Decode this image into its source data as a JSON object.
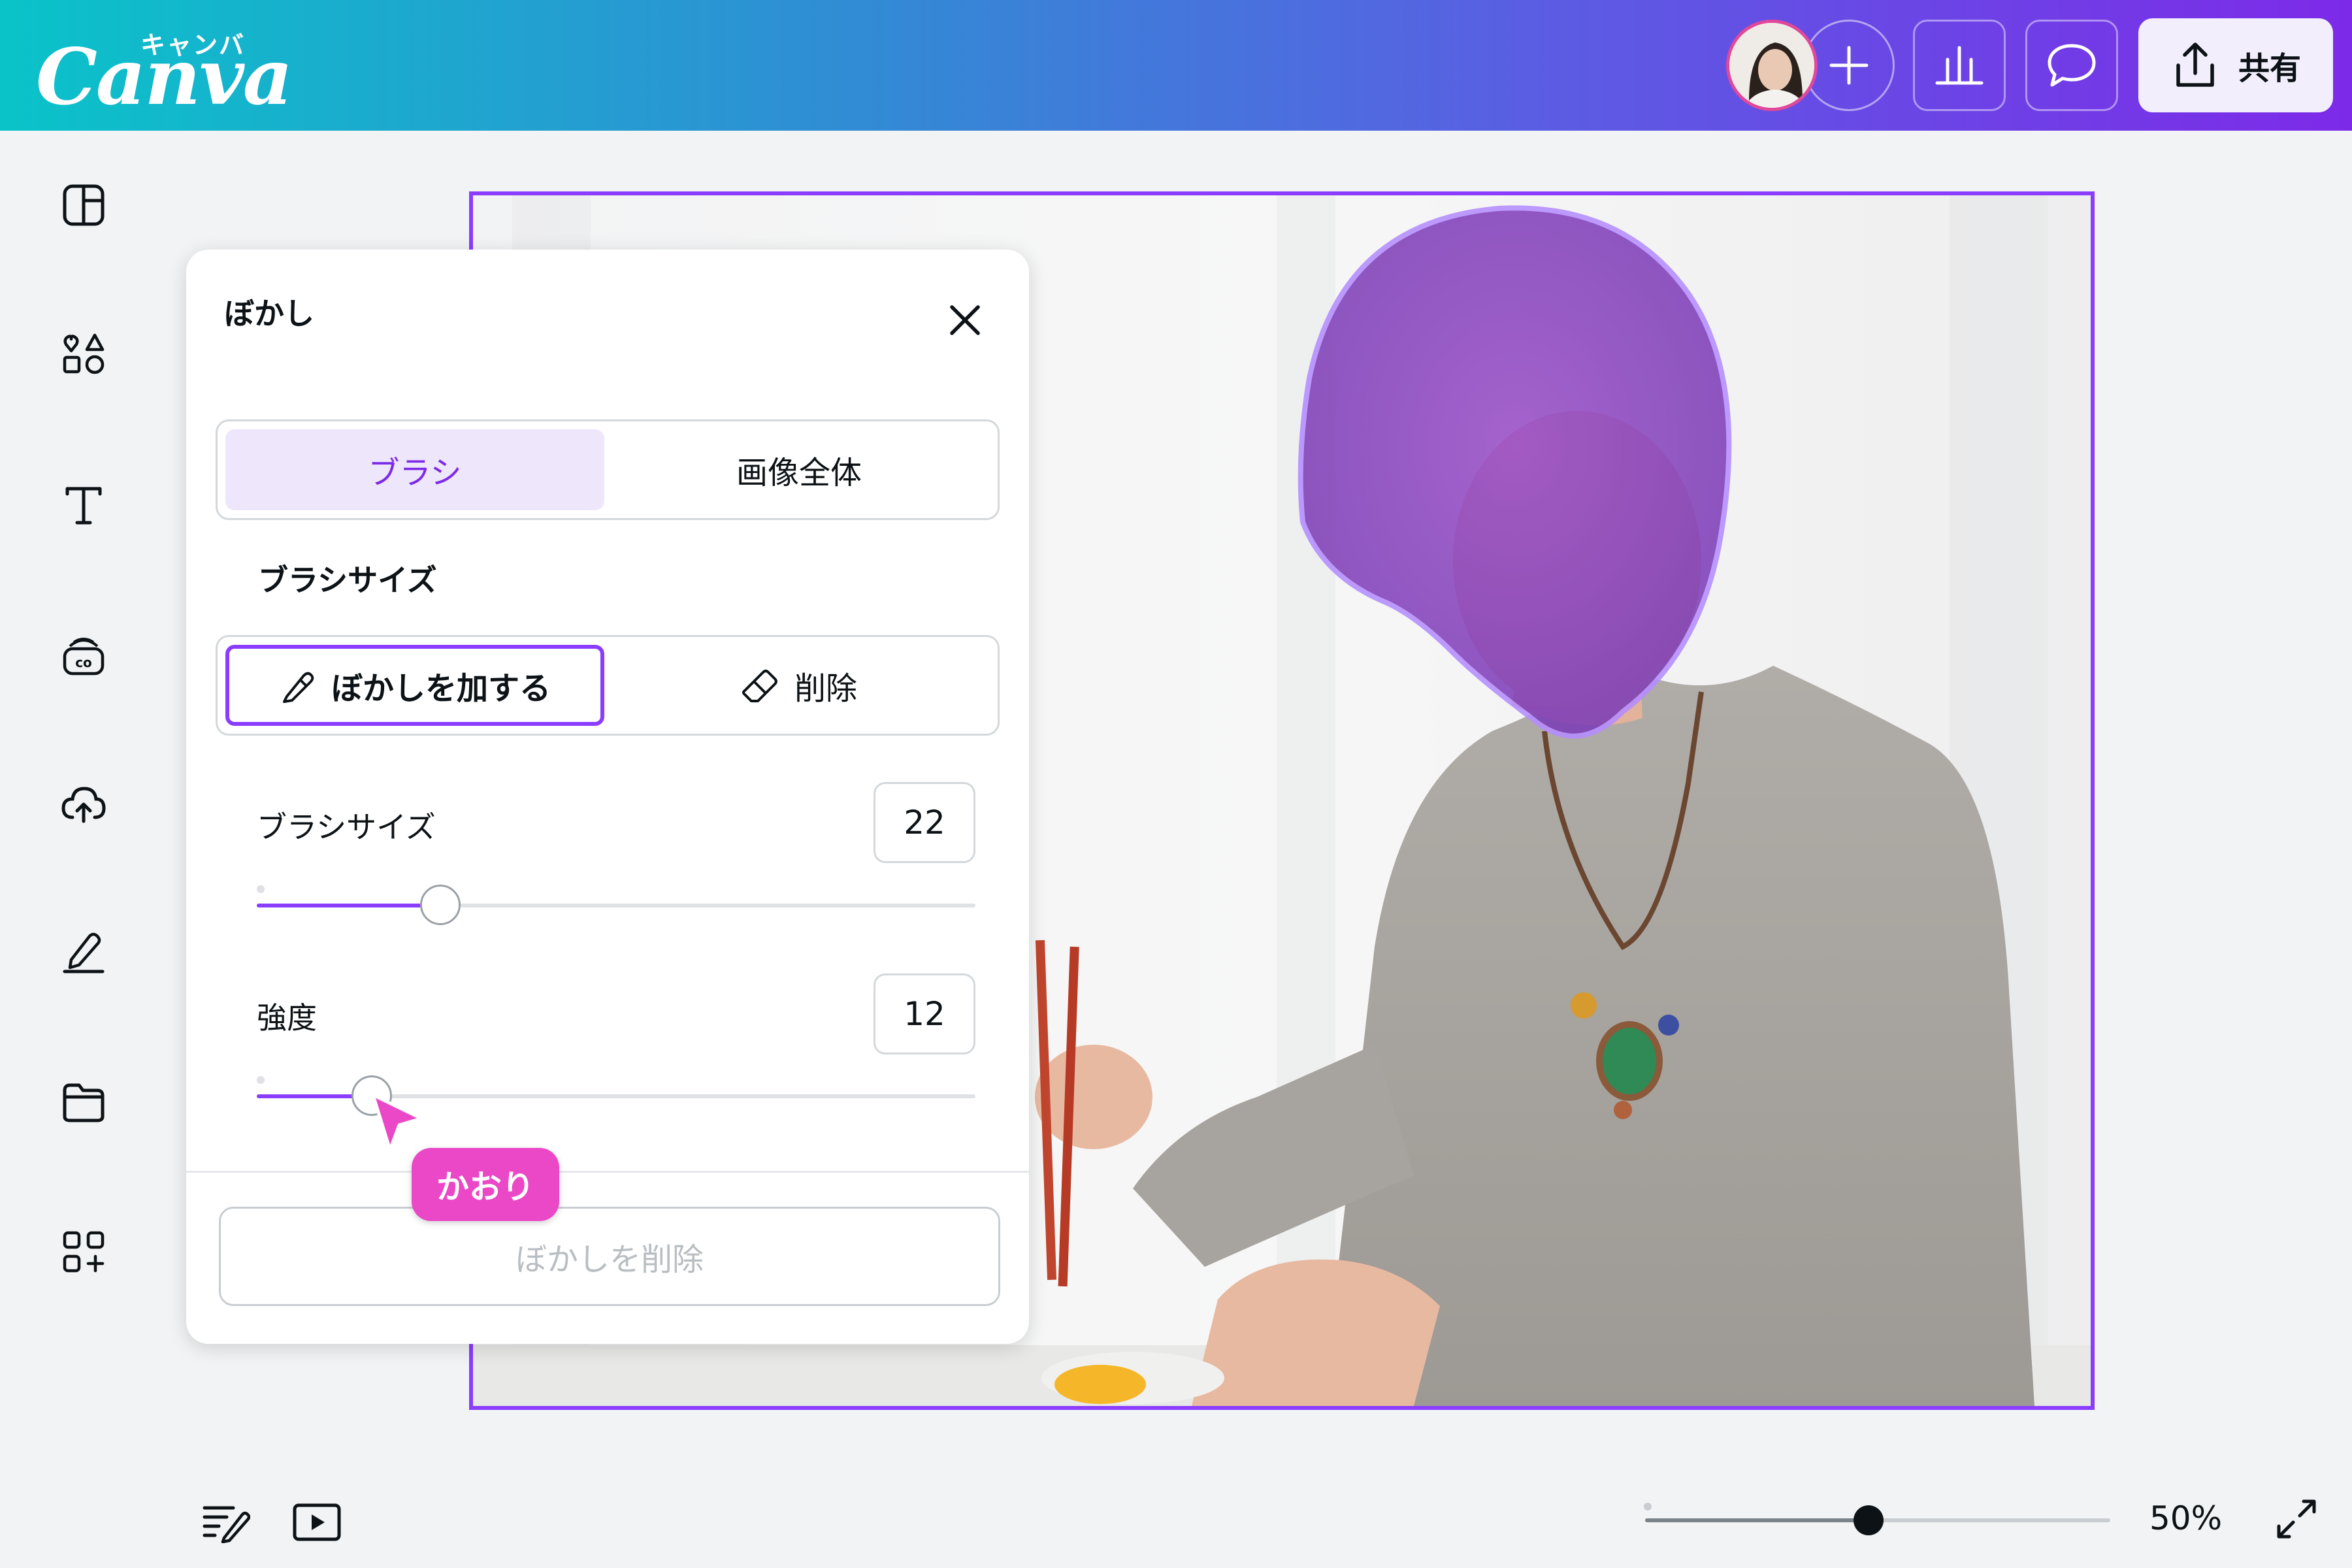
{
  "app": {
    "logo_text": "Canva",
    "logo_kana": "キャンバ",
    "brand_purple": "#8b3dff",
    "header_gradient": [
      "#0ac3c9",
      "#7d2ae8"
    ]
  },
  "header": {
    "avatar_icon": "user-avatar",
    "add_icon": "plus-icon",
    "stats_icon": "bar-chart-icon",
    "comment_icon": "speech-bubble-icon",
    "share_icon": "upload-icon",
    "share_label": "共有"
  },
  "sidebar": {
    "items": [
      {
        "icon": "layout-template-icon"
      },
      {
        "icon": "shapes-elements-icon"
      },
      {
        "icon": "text-icon"
      },
      {
        "icon": "brand-kit-icon"
      },
      {
        "icon": "cloud-upload-icon"
      },
      {
        "icon": "draw-pen-icon"
      },
      {
        "icon": "folder-icon"
      },
      {
        "icon": "apps-grid-icon"
      }
    ]
  },
  "blur_panel": {
    "title": "ぼかし",
    "mode_tabs": [
      "ブラシ",
      "画像全体"
    ],
    "selected_mode": "ブラシ",
    "brush_section_label": "ブラシサイズ",
    "tool_tabs": [
      "ぼかしを加する",
      "削除"
    ],
    "selected_tool": "ぼかしを加する",
    "brush_size": {
      "label": "ブラシサイズ",
      "value": "22",
      "fraction": 0.255
    },
    "intensity": {
      "label": "強度",
      "value": "12",
      "fraction": 0.16
    },
    "remove_button": "ぼかしを削除"
  },
  "collaborator": {
    "name": "かおり",
    "color": "#ea48c6"
  },
  "bottom_bar": {
    "notes_icon": "notes-icon",
    "present_icon": "play-icon",
    "zoom_label": "50%",
    "zoom_fraction": 0.48,
    "fullscreen_icon": "expand-icon"
  }
}
